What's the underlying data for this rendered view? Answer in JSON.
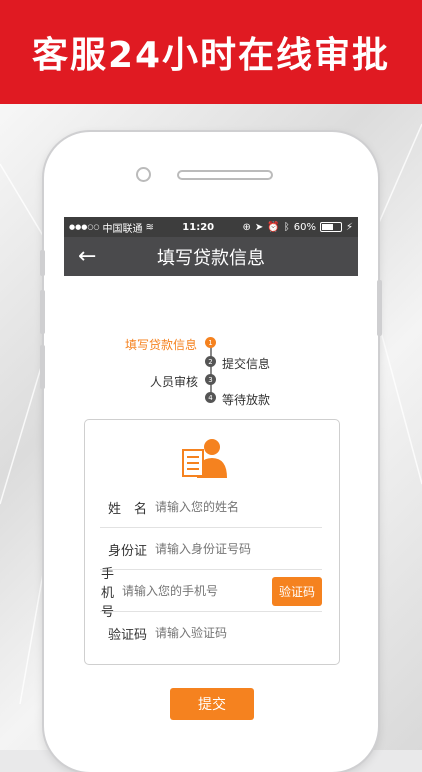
{
  "banner": {
    "title": "客服24小时在线审批"
  },
  "statusbar": {
    "signal": "●●●○○",
    "carrier": "中国联通",
    "time": "11:20",
    "battery": "60%"
  },
  "navbar": {
    "back_icon": "←",
    "title": "填写贷款信息"
  },
  "progress": {
    "steps": [
      {
        "num": "1",
        "label": "填写贷款信息",
        "active": true
      },
      {
        "num": "2",
        "label": "提交信息",
        "active": false
      },
      {
        "num": "3",
        "label": "人员审核",
        "active": false
      },
      {
        "num": "4",
        "label": "等待放款",
        "active": false
      }
    ]
  },
  "form": {
    "fields": [
      {
        "label": "姓　名",
        "placeholder": "请输入您的姓名"
      },
      {
        "label": "身份证",
        "placeholder": "请输入身份证号码"
      },
      {
        "label": "手机号",
        "placeholder": "请输入您的手机号"
      },
      {
        "label": "验证码",
        "placeholder": "请输入验证码"
      }
    ],
    "code_button": "验证码"
  },
  "submit_label": "提交",
  "colors": {
    "brand_red": "#e01a22",
    "accent_orange": "#f5821f",
    "nav_dark": "#4a4a4c"
  }
}
